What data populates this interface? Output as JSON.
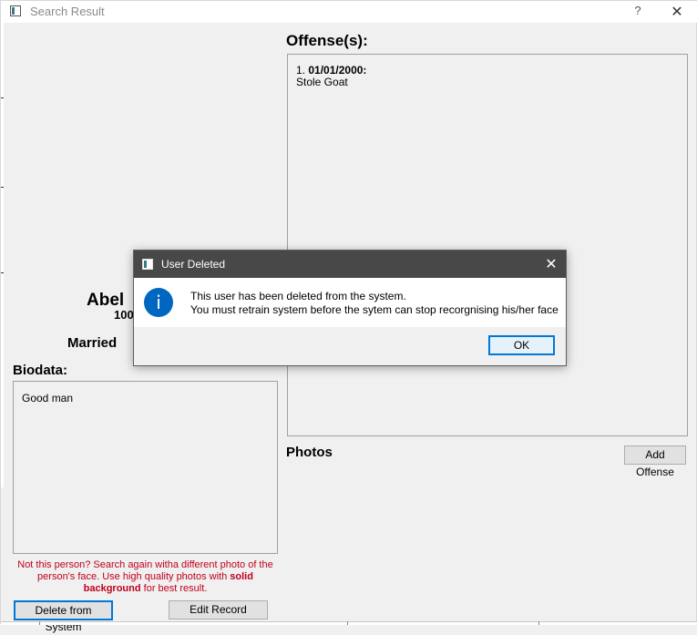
{
  "window": {
    "title": "Search Result",
    "help_label": "?",
    "close_label": "✕"
  },
  "offenses": {
    "heading": "Offense(s):",
    "items": [
      {
        "number": "1.",
        "date": "01/01/2000:",
        "description": "Stole Goat"
      }
    ]
  },
  "photos": {
    "heading": "Photos"
  },
  "buttons": {
    "add_offense": "Add Offense",
    "delete_from_system": "Delete from System",
    "edit_record": "Edit Record"
  },
  "person": {
    "name": "Abel",
    "id": "100",
    "marital_status": "Married"
  },
  "biodata": {
    "heading": "Biodata:",
    "text": "Good man"
  },
  "hint": {
    "part1": "Not this person? Search again witha different photo of the person's face. Use high quality photos with ",
    "bold": "solid background",
    "part2": " for best result."
  },
  "dialog": {
    "title": "User Deleted",
    "close_label": "✕",
    "icon": "info-icon",
    "icon_glyph": "i",
    "message_line1": "This user has been deleted from the system.",
    "message_line2": "You must retrain system before the sytem can stop recorgnising his/her face",
    "ok_label": "OK"
  },
  "colors": {
    "hint_red": "#c0001c",
    "accent_blue": "#0078d7",
    "dialog_titlebar": "#484848",
    "info_icon": "#0067c0"
  }
}
